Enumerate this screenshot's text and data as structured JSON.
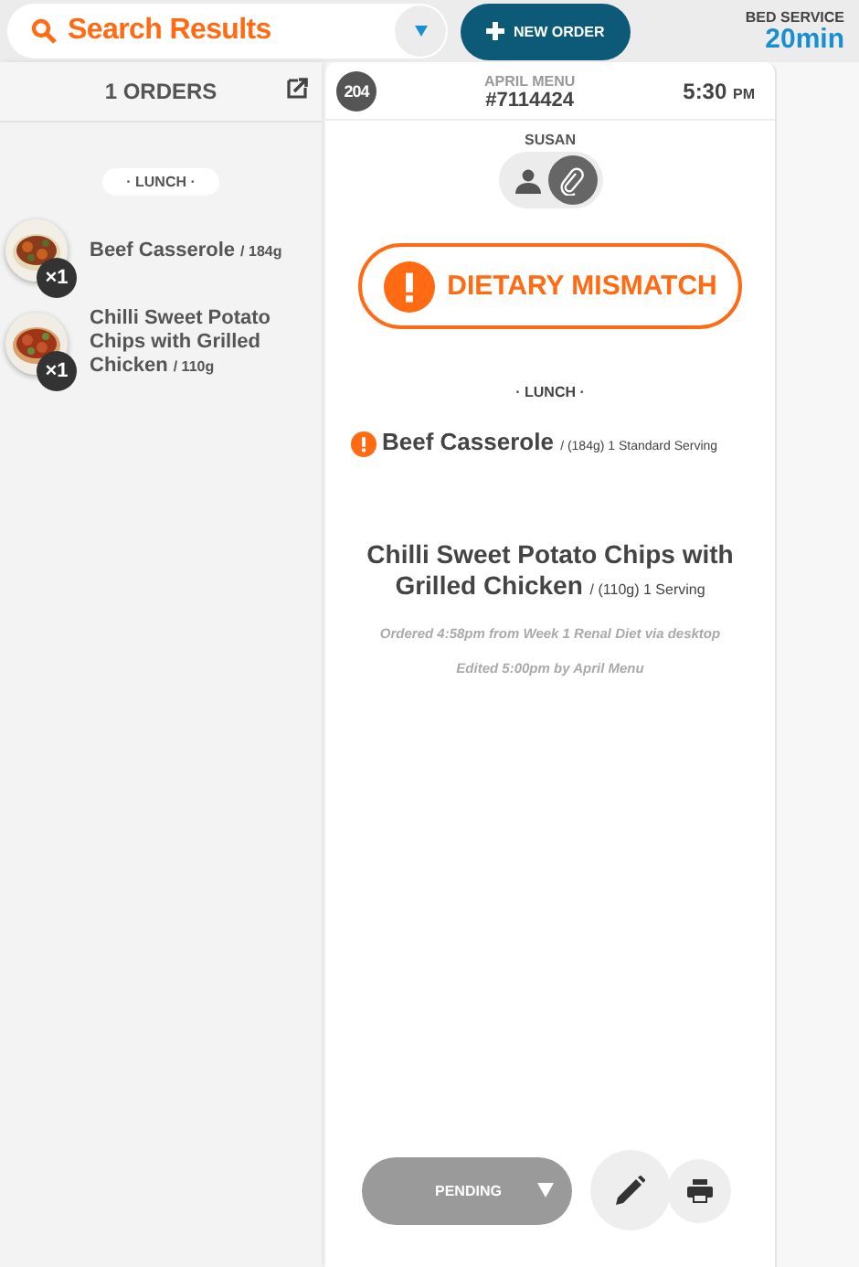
{
  "search": {
    "value": "Search Results"
  },
  "new_order_button": {
    "label": "NEW ORDER"
  },
  "bed_service": {
    "label": "BED SERVICE",
    "value": "20min"
  },
  "order_list": {
    "header": "1 ORDERS",
    "meal": "· LUNCH ·",
    "items": [
      {
        "name": "Beef Casserole",
        "weight": "/ 184g",
        "quantity": "×1",
        "kind": "casserole"
      },
      {
        "name": "Chilli Sweet Potato Chips with Grilled Chicken",
        "weight": "/ 110g",
        "quantity": "×1",
        "kind": "chicken"
      }
    ]
  },
  "order": {
    "room": "204",
    "menu": "APRIL MENU",
    "number": "#7114424",
    "time": "5:30",
    "meridiem": "PM",
    "patient": "SUSAN",
    "attachment_active": true,
    "alert": "DIETARY MISMATCH",
    "meal": "· LUNCH ·",
    "items": [
      {
        "name": "Beef Casserole",
        "detail": "/ (184g) 1 Standard Serving",
        "flagged": true
      },
      {
        "name": "Chilli Sweet Potato Chips with Grilled Chicken",
        "detail": "/ (110g) 1 Serving",
        "flagged": false
      }
    ],
    "notes": [
      "Ordered 4:58pm from Week 1 Renal Diet via desktop",
      "Edited 5:00pm by April Menu"
    ],
    "status": "PENDING"
  }
}
